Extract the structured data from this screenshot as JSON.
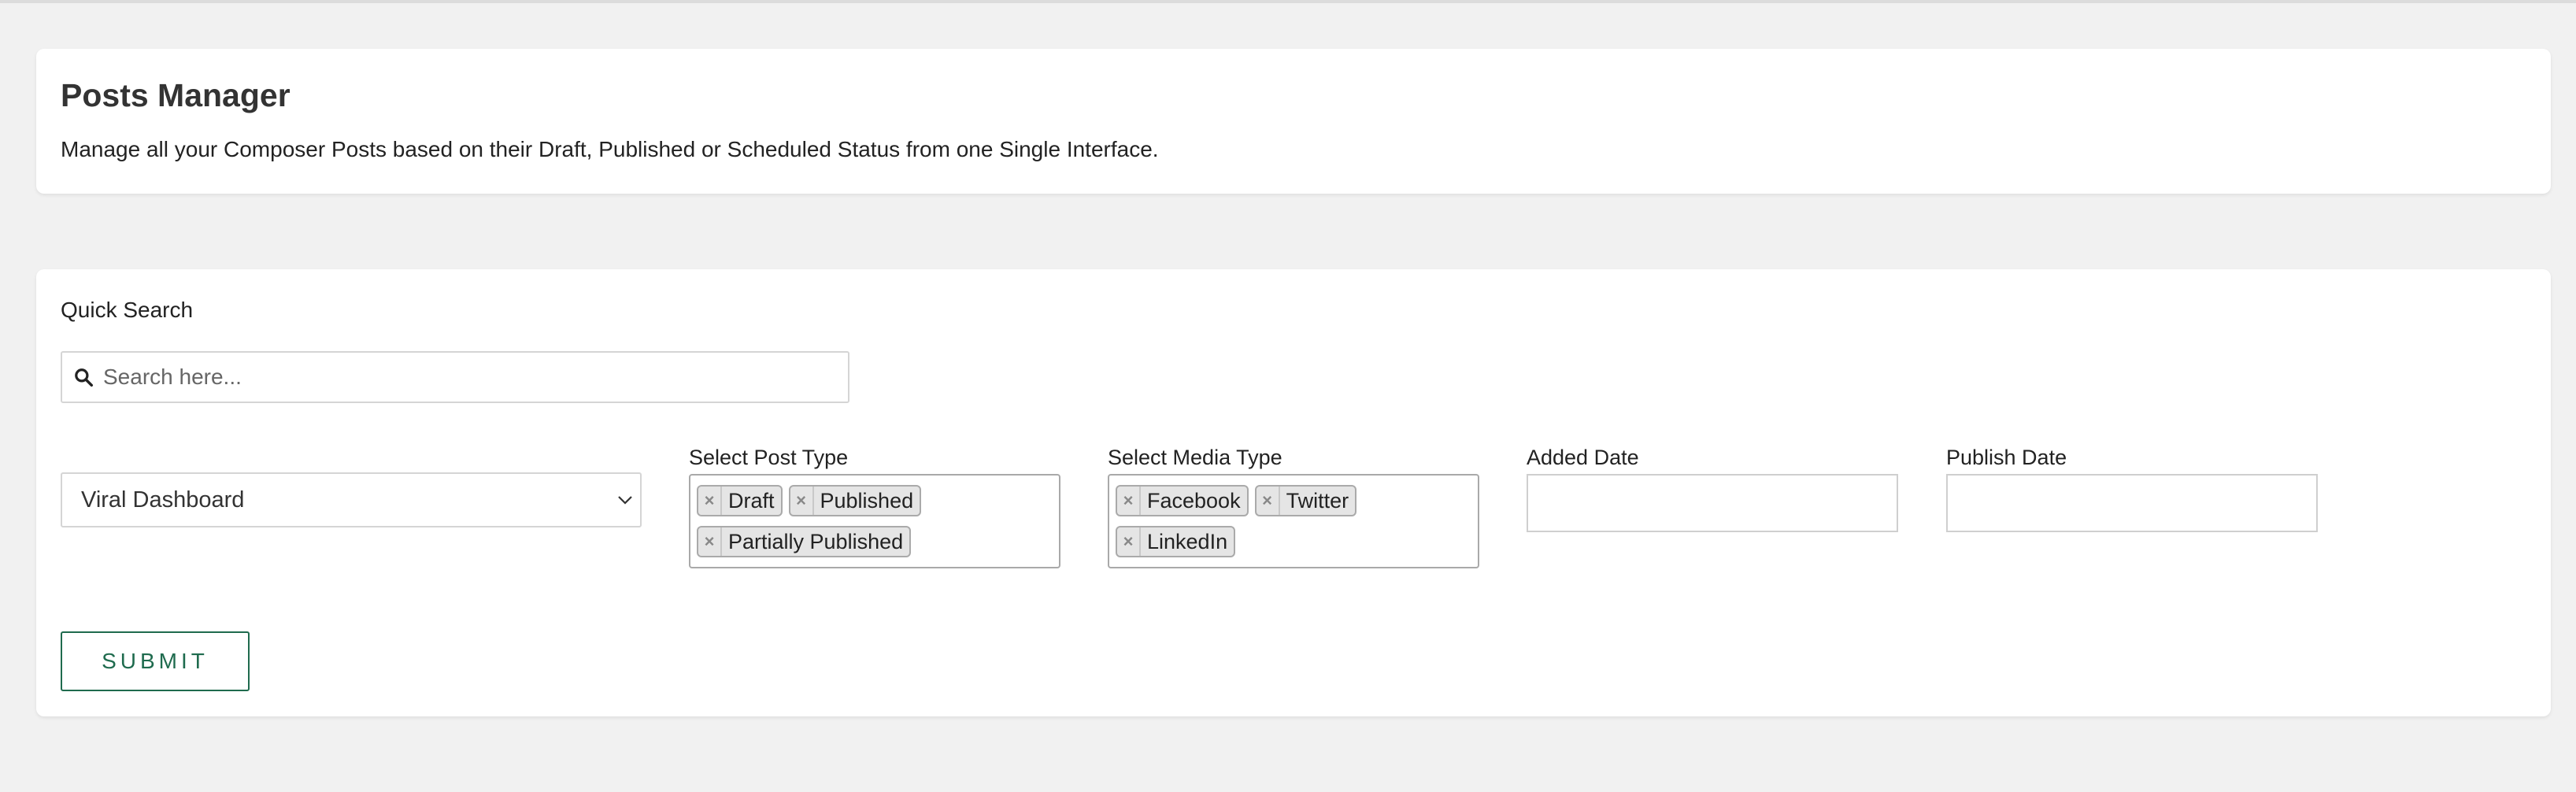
{
  "header": {
    "title": "Posts Manager",
    "subtitle": "Manage all your Composer Posts based on their Draft, Published or Scheduled Status from one Single Interface."
  },
  "filters": {
    "quick_search_label": "Quick Search",
    "search_placeholder": "Search here...",
    "search_value": "",
    "dashboard_selected": "Viral Dashboard",
    "post_type_label": "Select Post Type",
    "post_types": [
      "Draft",
      "Published",
      "Partially Published"
    ],
    "media_type_label": "Select Media Type",
    "media_types": [
      "Facebook",
      "Twitter",
      "LinkedIn"
    ],
    "added_date_label": "Added Date",
    "added_date_value": "",
    "publish_date_label": "Publish Date",
    "publish_date_value": "",
    "submit_label": "SUBMIT"
  },
  "colors": {
    "accent": "#1f6b4e",
    "page_background": "#f1f1f1",
    "card_background": "#ffffff"
  },
  "icons": {
    "search": "search-icon",
    "dropdown": "chevron-down-icon",
    "tag_remove": "close-icon"
  }
}
